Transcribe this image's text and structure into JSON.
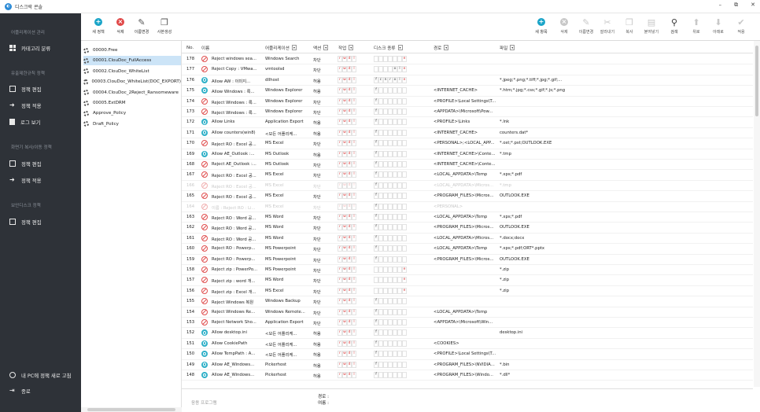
{
  "window": {
    "title": "디스크락 콘솔",
    "minimize": "–",
    "restore": "⧉",
    "close": "✕"
  },
  "sidebar": {
    "section1": "어플리케이션 관리",
    "item_category": "카테고리 분류",
    "section2": "유출제한규칙 정책",
    "item_edit1": "정책 편집",
    "item_apply1": "정책 적용",
    "item_log": "로그 보기",
    "section3": "화면기 복사/이동 정책",
    "item_edit2": "정책 편집",
    "item_apply2": "정책 적용",
    "section4": "보안디스크 정책",
    "item_edit3": "정책 편집",
    "refresh": "내 PC에 정책 새로 고침",
    "exit": "종료"
  },
  "toolbar_left": [
    {
      "label": "새 정책",
      "icon": "add-icon",
      "color": "#1aa4c8"
    },
    {
      "label": "삭제",
      "icon": "delete-icon",
      "color": "#e04848"
    },
    {
      "label": "이름변경",
      "icon": "edit-icon",
      "color": "#555"
    },
    {
      "label": "사본생성",
      "icon": "copy-icon",
      "color": "#555"
    }
  ],
  "toolbar_right": [
    {
      "label": "새 항목",
      "icon": "add-icon",
      "enabled": true
    },
    {
      "label": "삭제",
      "icon": "delete-icon",
      "enabled": false
    },
    {
      "label": "이름변경",
      "icon": "edit-icon",
      "enabled": false
    },
    {
      "label": "잘라내기",
      "icon": "scissors-icon",
      "enabled": false
    },
    {
      "label": "복사",
      "icon": "copy-icon",
      "enabled": false
    },
    {
      "label": "붙여넣기",
      "icon": "paste-icon",
      "enabled": false
    },
    {
      "label": "검색",
      "icon": "search-icon",
      "enabled": true
    },
    {
      "label": "위로",
      "icon": "arrow-up-icon",
      "enabled": false
    },
    {
      "label": "아래로",
      "icon": "arrow-down-icon",
      "enabled": false
    },
    {
      "label": "적용",
      "icon": "check-icon",
      "enabled": false
    }
  ],
  "policies": [
    {
      "name": "00000.Free",
      "selected": false
    },
    {
      "name": "00001.ClouDoc_FullAccess",
      "selected": true
    },
    {
      "name": "00002.ClouDoc_WhiteList",
      "selected": false
    },
    {
      "name": "00003.ClouDoc_WhiteList(DOC_EXPORT)",
      "selected": false
    },
    {
      "name": "00004.ClouDoc_2Reject_Ransomeware",
      "selected": false
    },
    {
      "name": "00005.ExtDRM",
      "selected": false
    },
    {
      "name": "Approve_Policy",
      "selected": false
    },
    {
      "name": "Draft_Policy",
      "selected": false
    }
  ],
  "columns": {
    "no": "No.",
    "name": "이름",
    "app": "어플리케이션",
    "action": "액션",
    "op": "작업",
    "disk": "디스크 종류",
    "path": "경로",
    "file": "파일"
  },
  "rows": [
    {
      "no": "178",
      "s": "deny",
      "name": "Reject windows sea...",
      "app": "Windows Search",
      "act": "차단",
      "op": "rwdl",
      "disk": "e",
      "path": "",
      "file": ""
    },
    {
      "no": "177",
      "s": "deny",
      "name": "Reject Copy : VMwa...",
      "app": "vmtoolsd",
      "act": "차단",
      "op": "rwdl",
      "disk": "ole",
      "path": "",
      "file": ""
    },
    {
      "no": "176",
      "s": "allow",
      "name": "Allow AW : 이미지...",
      "app": "dllhost",
      "act": "허용",
      "op": "rwdl",
      "disk": "fcnrole",
      "path": "",
      "file": "*.jpeg;*.png;*.tiff;*.jpg;*.gif;..."
    },
    {
      "no": "175",
      "s": "allow",
      "name": "Allow Windows : 록...",
      "app": "Windows Explorer",
      "act": "허용",
      "op": "rwdl",
      "disk": "f",
      "path": "<INTERNET_CACHE>",
      "file": "*.htm;*.jpg;*.css;*.gif;*.js;*.png"
    },
    {
      "no": "174",
      "s": "deny",
      "name": "Reject Windows : 록...",
      "app": "Windows Explorer",
      "act": "차단",
      "op": "rwdl",
      "disk": "f",
      "path": "<PROFILE>\\Local Settings\\T...",
      "file": ""
    },
    {
      "no": "173",
      "s": "deny",
      "name": "Reject Windows : 록...",
      "app": "Windows Explorer",
      "act": "차단",
      "op": "rwdl",
      "disk": "f",
      "path": "<APPDATA>\\Microsoft\\Pow...",
      "file": ""
    },
    {
      "no": "172",
      "s": "allow",
      "name": "Allow Links",
      "app": "Application Export",
      "act": "허용",
      "op": "rwdl",
      "disk": "f",
      "path": "<PROFILE>\\Links",
      "file": "*.lnk"
    },
    {
      "no": "171",
      "s": "allow",
      "name": "Allow counters(win8)",
      "app": "<모든 어플리케...",
      "act": "허용",
      "op": "rwdl",
      "disk": "f",
      "path": "<INTERNET_CACHE>",
      "file": "counters.dat*"
    },
    {
      "no": "170",
      "s": "deny",
      "name": "Reject RO : Excel 공...",
      "app": "MS Excel",
      "act": "차단",
      "op": "rwdl",
      "disk": "f",
      "path": "<PERSONAL>;<LOCAL_APP...",
      "file": "*.ost;*.pst;OUTLOOK.EXE"
    },
    {
      "no": "169",
      "s": "allow",
      "name": "Allow AE_Outlook :...",
      "app": "MS Outlook",
      "act": "허용",
      "op": "rwdl",
      "disk": "f",
      "path": "<INTERNET_CACHE>\\Conte...",
      "file": "*.tmp"
    },
    {
      "no": "168",
      "s": "deny",
      "name": "Reject AE_Outlook :...",
      "app": "MS Outlook",
      "act": "차단",
      "op": "rwdl",
      "disk": "f",
      "path": "<INTERNET_CACHE>\\Conte...",
      "file": ""
    },
    {
      "no": "167",
      "s": "deny",
      "name": "Reject RO : Excel 공...",
      "app": "MS Excel",
      "act": "차단",
      "op": "rwdl",
      "disk": "f",
      "path": "<LOCAL_APPDATA>\\Temp",
      "file": "*.xps;*.pdf"
    },
    {
      "no": "166",
      "s": "deny",
      "dim": true,
      "name": "Reject RO : Excel 공...",
      "app": "MS Excel",
      "act": "차단",
      "op": "rwdl",
      "disk": "f",
      "path": "<LOCAL_APPDATA>\\Micros...",
      "file": "*.tmp"
    },
    {
      "no": "165",
      "s": "deny",
      "name": "Reject RO : Excel 공...",
      "app": "MS Excel",
      "act": "차단",
      "op": "rwdl",
      "disk": "f",
      "path": "<PROGRAM_FILES>\\Micros...",
      "file": "OUTLOOK.EXE"
    },
    {
      "no": "164",
      "s": "deny",
      "dim": true,
      "name": "이름 : Reject RO : Li...",
      "app": "MS Excel",
      "act": "차단",
      "op": "rwdl",
      "disk": "f",
      "path": "<PERSONAL>",
      "file": ""
    },
    {
      "no": "163",
      "s": "deny",
      "name": "Reject RO : Word 공...",
      "app": "MS Word",
      "act": "차단",
      "op": "rwdl",
      "disk": "f",
      "path": "<LOCAL_APPDATA>\\Temp",
      "file": "*.xps;*.pdf"
    },
    {
      "no": "162",
      "s": "deny",
      "name": "Reject RO : Word 공...",
      "app": "MS Word",
      "act": "차단",
      "op": "rwdl",
      "disk": "f",
      "path": "<PROGRAM_FILES>\\Micros...",
      "file": "OUTLOOK.EXE"
    },
    {
      "no": "161",
      "s": "deny",
      "name": "Reject RO : Word 공...",
      "app": "MS Word",
      "act": "차단",
      "op": "rwdl",
      "disk": "f",
      "path": "<LOCAL_APPDATA>\\Micros...",
      "file": "*.docx;docx"
    },
    {
      "no": "160",
      "s": "deny",
      "name": "Reject RO : Powerp...",
      "app": "MS Powerpoint",
      "act": "차단",
      "op": "rwdl",
      "disk": "f",
      "path": "<LOCAL_APPDATA>\\Temp",
      "file": "*.xps;*.pdf;ORT*.pptx"
    },
    {
      "no": "159",
      "s": "deny",
      "name": "Reject RO : Powerp...",
      "app": "MS Powerpoint",
      "act": "차단",
      "op": "rwdl",
      "disk": "f",
      "path": "<PROGRAM_FILES>\\Micros...",
      "file": "OUTLOOK.EXE"
    },
    {
      "no": "158",
      "s": "deny",
      "name": "Reject zip : PowerPo...",
      "app": "MS Powerpoint",
      "act": "차단",
      "op": "rwdl",
      "disk": "e",
      "path": "",
      "file": "*.zip"
    },
    {
      "no": "157",
      "s": "deny",
      "name": "Reject zip : word 개...",
      "app": "MS Word",
      "act": "차단",
      "op": "rwdl",
      "disk": "e",
      "path": "",
      "file": "*.zip"
    },
    {
      "no": "156",
      "s": "deny",
      "name": "Reject zip : Excel 개...",
      "app": "MS Excel",
      "act": "차단",
      "op": "rwdl",
      "disk": "e",
      "path": "",
      "file": "*.zip"
    },
    {
      "no": "155",
      "s": "deny",
      "name": "Reject Windows 복원",
      "app": "Windows Backup",
      "act": "차단",
      "op": "rwdl",
      "disk": "f",
      "path": "",
      "file": ""
    },
    {
      "no": "154",
      "s": "deny",
      "name": "Reject Windows Re...",
      "app": "Windows Remote...",
      "act": "차단",
      "op": "rwdl",
      "disk": "f",
      "path": "<LOCAL_APPDATA>\\Temp",
      "file": ""
    },
    {
      "no": "153",
      "s": "deny",
      "name": "Reject Network Sho...",
      "app": "Application Export",
      "act": "차단",
      "op": "rwdl",
      "disk": "f",
      "path": "<APPDATA>\\Microsoft\\Win...",
      "file": ""
    },
    {
      "no": "152",
      "s": "allow",
      "name": "Allow desktop.ini",
      "app": "<모든 어플리케...",
      "act": "허용",
      "op": "rwdl",
      "disk": "f",
      "path": "",
      "file": "desktop.ini"
    },
    {
      "no": "151",
      "s": "allow",
      "name": "Allow CookiePath",
      "app": "<모든 어플리케...",
      "act": "허용",
      "op": "rwdl",
      "disk": "f",
      "path": "<COOKIES>",
      "file": ""
    },
    {
      "no": "150",
      "s": "allow",
      "name": "Allow TempPath : A...",
      "app": "<모든 어플리케...",
      "act": "허용",
      "op": "rwdl",
      "disk": "f",
      "path": "<PROFILE>\\Local Settings\\T...",
      "file": ""
    },
    {
      "no": "149",
      "s": "allow",
      "name": "Allow AE_Windows...",
      "app": "Pickerhost",
      "act": "허용",
      "op": "rwdl",
      "disk": "f",
      "path": "<PROGRAM_FILES>\\NVIDIA...",
      "file": "*.bin"
    },
    {
      "no": "148",
      "s": "allow",
      "name": "Allow AE_Windows...",
      "app": "Pickerhost",
      "act": "허용",
      "op": "rwdl",
      "disk": "f",
      "path": "<PROGRAM_FILES>\\Windo...",
      "file": "*.dll*"
    }
  ],
  "bottom": {
    "apply_program": "응용 프로그램",
    "path_label": "경로 :",
    "file_label": "여름 :"
  }
}
